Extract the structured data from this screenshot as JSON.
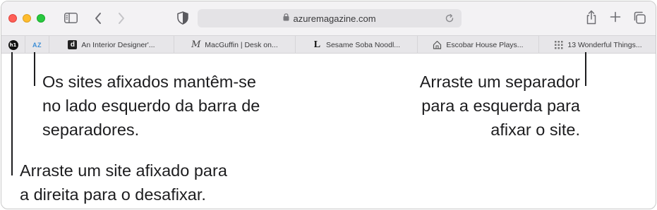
{
  "window": {
    "traffic_lights": [
      "close",
      "minimize",
      "maximize"
    ],
    "toolbar": {
      "icons": [
        "sidebar-icon",
        "back-icon",
        "forward-icon",
        "privacy-shield-icon",
        "share-icon",
        "new-tab-icon",
        "tab-overview-icon"
      ],
      "address": {
        "url": "azuremagazine.com",
        "lock_icon": "lock-icon",
        "reload_icon": "reload-icon"
      }
    },
    "tab_bar": {
      "pinned": [
        {
          "favicon_text": "h1",
          "favicon": "circle-badge"
        },
        {
          "favicon_text": "AZ",
          "favicon": "text-badge",
          "active": true
        }
      ],
      "tabs": [
        {
          "title": "An Interior Designer'...",
          "favicon": "d-square",
          "favicon_text": "d"
        },
        {
          "title": "MacGuffin | Desk on...",
          "favicon": "m-script",
          "favicon_text": "M"
        },
        {
          "title": "Sesame Soba Noodl...",
          "favicon": "l-serif",
          "favicon_text": "L"
        },
        {
          "title": "Escobar House Plays...",
          "favicon": "house-icon"
        },
        {
          "title": "13 Wonderful Things...",
          "favicon": "grid-icon"
        }
      ]
    }
  },
  "callouts": {
    "pinned_sites": {
      "lines": [
        "Os sites afixados mantêm-se",
        "no lado esquerdo da barra de",
        "separadores."
      ]
    },
    "drag_tab_left": {
      "lines": [
        "Arraste um separador",
        "para a esquerda para",
        "afixar o site."
      ]
    },
    "drag_pinned_right": {
      "lines": [
        "Arraste um site afixado para",
        "a direita para o desafixar."
      ]
    }
  },
  "colors": {
    "toolbar_bg": "#f3f2f4",
    "tab_bar_bg": "#e7e6e9",
    "close": "#ff5f57",
    "minimize": "#febc2e",
    "maximize": "#28c840",
    "az_accent": "#3f8fd6"
  }
}
